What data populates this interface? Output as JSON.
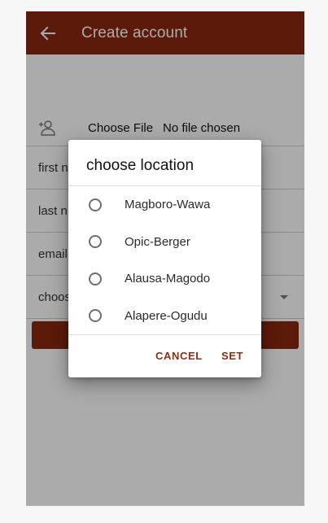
{
  "colors": {
    "brand": "#8a2810",
    "accent": "#8a2f14",
    "scrim": "rgba(0,0,0,0.33)"
  },
  "appbar": {
    "title": "Create account",
    "back_icon": "arrow-left-icon"
  },
  "form": {
    "photo_icon": "add-user-icon",
    "choose_file_label": "Choose File",
    "no_file_text": "No file chosen",
    "first_name_label": "first n",
    "last_name_label": "last n",
    "email_label": "email",
    "location_label": "choos",
    "location_arrow_icon": "dropdown-arrow-icon"
  },
  "dialog": {
    "title": "choose location",
    "options": [
      {
        "label": "Magboro-Wawa",
        "selected": false
      },
      {
        "label": "Opic-Berger",
        "selected": false
      },
      {
        "label": "Alausa-Magodo",
        "selected": false
      },
      {
        "label": "Alapere-Ogudu",
        "selected": false
      }
    ],
    "cancel_label": "CANCEL",
    "set_label": "SET"
  }
}
